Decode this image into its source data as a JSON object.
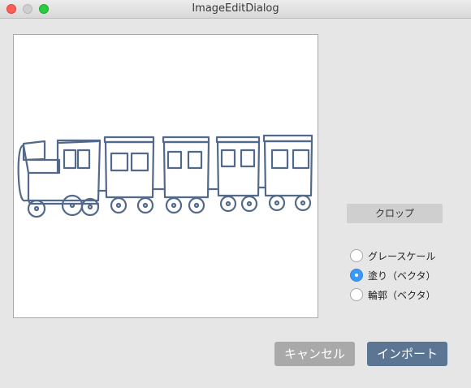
{
  "window": {
    "title": "ImageEditDialog",
    "controls": [
      "close-button",
      "minimize-button",
      "zoom-button"
    ]
  },
  "preview": {
    "image_subject": "hand-drawn train outline (locomotive with four carriages)",
    "stroke_color": "#53698a"
  },
  "crop_button": {
    "label": "クロップ"
  },
  "mode_options": {
    "items": [
      {
        "label": "グレースケール",
        "checked": false
      },
      {
        "label": "塗り（ベクタ）",
        "checked": true
      },
      {
        "label": "輪郭（ベクタ）",
        "checked": false
      }
    ]
  },
  "footer": {
    "cancel_label": "キャンセル",
    "import_label": "インポート"
  },
  "colors": {
    "accent_radio": "#3b98f5",
    "import_button": "#5c7593",
    "cancel_button": "#a9a9a9"
  }
}
